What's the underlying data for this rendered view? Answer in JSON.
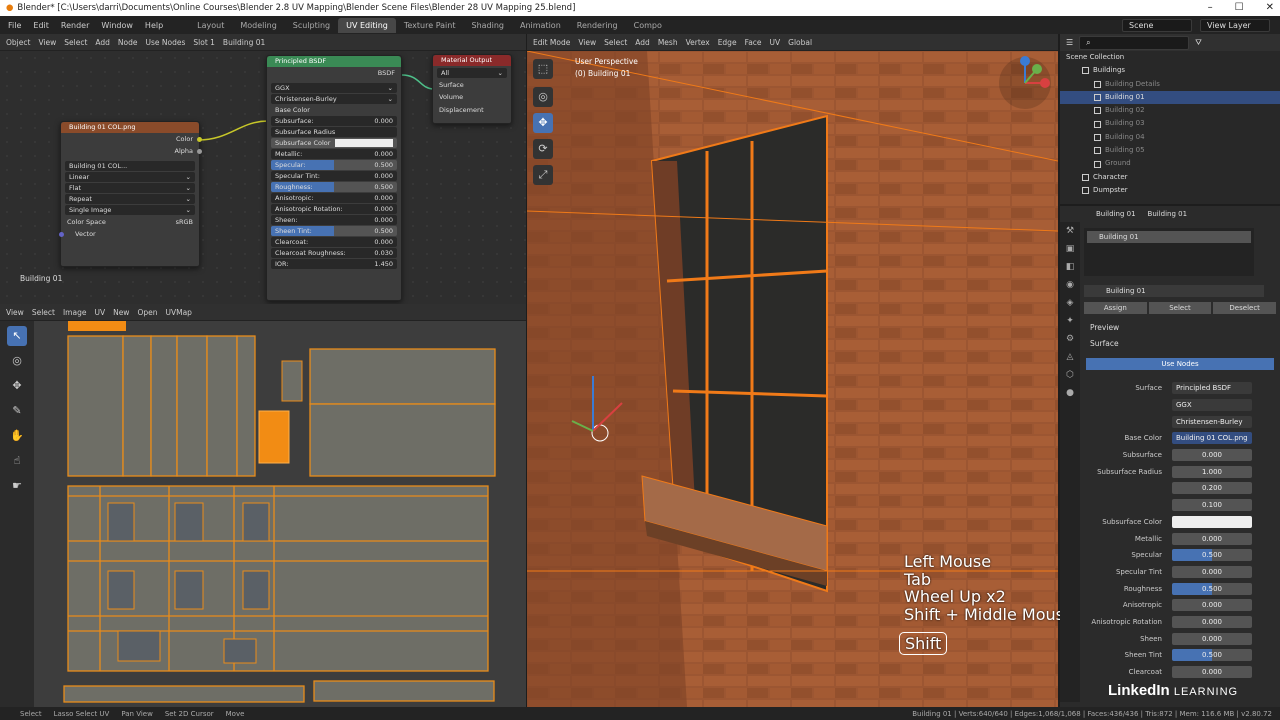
{
  "window": {
    "title": "Blender* [C:\\Users\\darri\\Documents\\Online Courses\\Blender 2.8 UV Mapping\\Blender Scene Files\\Blender 28 UV Mapping 25.blend]"
  },
  "topbar": {
    "menus": [
      "File",
      "Edit",
      "Render",
      "Window",
      "Help"
    ],
    "workspaces": [
      "Layout",
      "Modeling",
      "Sculpting",
      "UV Editing",
      "Texture Paint",
      "Shading",
      "Animation",
      "Rendering",
      "Compo"
    ],
    "active_workspace": "UV Editing",
    "scene": "Scene",
    "view_layer": "View Layer"
  },
  "node_editor": {
    "header": [
      "Object",
      "View",
      "Select",
      "Add",
      "Node",
      "Use Nodes",
      "Slot 1",
      "Building 01"
    ],
    "image_node": {
      "title": "Building 01 COL.png",
      "outputs": [
        "Color",
        "Alpha"
      ],
      "image": "Building 01 COL...",
      "options": [
        "Linear",
        "Flat",
        "Repeat",
        "Single Image"
      ],
      "color_space_label": "Color Space",
      "color_space": "sRGB",
      "input": "Vector"
    },
    "bsdf_node": {
      "title": "Principled BSDF",
      "output": "BSDF",
      "dist": "GGX",
      "sss": "Christensen-Burley",
      "rows": [
        {
          "label": "Base Color",
          "value": "",
          "kind": "plain"
        },
        {
          "label": "Subsurface:",
          "value": "0.000",
          "kind": "dark"
        },
        {
          "label": "Subsurface Radius",
          "value": "",
          "kind": "dark"
        },
        {
          "label": "Subsurface Color",
          "value": "",
          "kind": "color"
        },
        {
          "label": "Metallic:",
          "value": "0.000",
          "kind": "dark"
        },
        {
          "label": "Specular:",
          "value": "0.500",
          "kind": "blue"
        },
        {
          "label": "Specular Tint:",
          "value": "0.000",
          "kind": "dark"
        },
        {
          "label": "Roughness:",
          "value": "0.500",
          "kind": "blue"
        },
        {
          "label": "Anisotropic:",
          "value": "0.000",
          "kind": "dark"
        },
        {
          "label": "Anisotropic Rotation:",
          "value": "0.000",
          "kind": "dark"
        },
        {
          "label": "Sheen:",
          "value": "0.000",
          "kind": "dark"
        },
        {
          "label": "Sheen Tint:",
          "value": "0.500",
          "kind": "blue"
        },
        {
          "label": "Clearcoat:",
          "value": "0.000",
          "kind": "dark"
        },
        {
          "label": "Clearcoat Roughness:",
          "value": "0.030",
          "kind": "dark"
        },
        {
          "label": "IOR:",
          "value": "1.450",
          "kind": "dark"
        }
      ]
    },
    "output_node": {
      "title": "Material Output",
      "target": "All",
      "inputs": [
        "Surface",
        "Volume",
        "Displacement"
      ]
    },
    "footer_label": "Building 01"
  },
  "uv_editor": {
    "header": [
      "View",
      "Select",
      "Image",
      "UV",
      "New",
      "Open",
      "UVMap"
    ]
  },
  "viewport": {
    "header": [
      "Edit Mode",
      "View",
      "Select",
      "Add",
      "Mesh",
      "Vertex",
      "Edge",
      "Face",
      "UV",
      "Global"
    ],
    "overlay_title": "User Perspective",
    "overlay_sub": "(0) Building 01",
    "keys": [
      "Left Mouse",
      "Tab",
      "Wheel Up x2",
      "Shift + Middle Mous"
    ],
    "shift": "Shift"
  },
  "outliner": {
    "title": "Scene Collection",
    "items": [
      {
        "label": "Buildings",
        "indent": 1,
        "sel": false
      },
      {
        "label": "Building Details",
        "indent": 2,
        "sel": false
      },
      {
        "label": "Building 01",
        "indent": 2,
        "sel": true
      },
      {
        "label": "Building 02",
        "indent": 2,
        "sel": false
      },
      {
        "label": "Building 03",
        "indent": 2,
        "sel": false
      },
      {
        "label": "Building 04",
        "indent": 2,
        "sel": false
      },
      {
        "label": "Building 05",
        "indent": 2,
        "sel": false
      },
      {
        "label": "Ground",
        "indent": 2,
        "sel": false
      },
      {
        "label": "Character",
        "indent": 1,
        "sel": false
      },
      {
        "label": "Dumpster",
        "indent": 1,
        "sel": false
      }
    ]
  },
  "properties": {
    "breadcrumb": [
      "Building 01",
      "Building 01"
    ],
    "slot": "Building 01",
    "material": "Building 01",
    "buttons": [
      "Assign",
      "Select",
      "Deselect"
    ],
    "panels": [
      "Preview",
      "Surface"
    ],
    "use_nodes": "Use Nodes",
    "surface_label": "Surface",
    "surface": "Principled BSDF",
    "dist": "GGX",
    "sss": "Christensen-Burley",
    "base_color_label": "Base Color",
    "base_color": "Building 01 COL.png",
    "rows": [
      {
        "label": "Subsurface",
        "value": "0.000",
        "kind": "n"
      },
      {
        "label": "Subsurface Radius",
        "value": "1.000",
        "kind": "n"
      },
      {
        "label": "",
        "value": "0.200",
        "kind": "n"
      },
      {
        "label": "",
        "value": "0.100",
        "kind": "n"
      },
      {
        "label": "Subsurface Color",
        "value": "",
        "kind": "w"
      },
      {
        "label": "Metallic",
        "value": "0.000",
        "kind": "n"
      },
      {
        "label": "Specular",
        "value": "0.500",
        "kind": "b"
      },
      {
        "label": "Specular Tint",
        "value": "0.000",
        "kind": "n"
      },
      {
        "label": "Roughness",
        "value": "0.500",
        "kind": "b"
      },
      {
        "label": "Anisotropic",
        "value": "0.000",
        "kind": "n"
      },
      {
        "label": "Anisotropic Rotation",
        "value": "0.000",
        "kind": "n"
      },
      {
        "label": "Sheen",
        "value": "0.000",
        "kind": "n"
      },
      {
        "label": "Sheen Tint",
        "value": "0.500",
        "kind": "b"
      },
      {
        "label": "Clearcoat",
        "value": "0.000",
        "kind": "n"
      }
    ]
  },
  "status": {
    "items": [
      "Select",
      "Lasso Select UV",
      "Pan View",
      "Set 2D Cursor",
      "Move"
    ],
    "info": "Building 01 | Verts:640/640 | Edges:1,068/1,068 | Faces:436/436 | Tris:872 | Mem: 116.6 MB | v2.80.72"
  },
  "overlay": {
    "brand": "LinkedIn",
    "brand_sub": "LEARNING"
  }
}
